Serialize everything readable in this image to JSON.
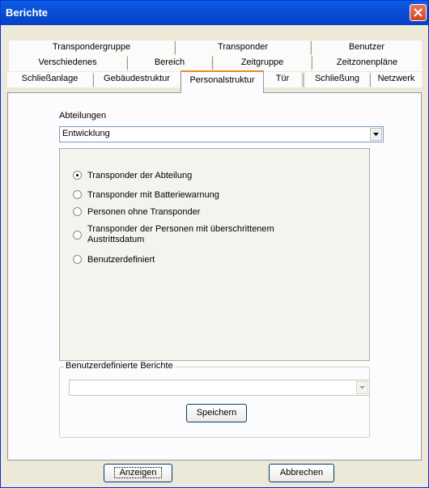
{
  "window": {
    "title": "Berichte"
  },
  "tabs": {
    "row1": [
      "Transpondergruppe",
      "Transponder",
      "Benutzer"
    ],
    "row2": [
      "Verschiedenes",
      "Bereich",
      "Zeitgruppe",
      "Zeitzonenpläne"
    ],
    "row3": [
      "Schließanlage",
      "Gebäudestruktur",
      "Personalstruktur",
      "Tür",
      "Schließung",
      "Netzwerk"
    ],
    "active": "Personalstruktur"
  },
  "departments": {
    "label": "Abteilungen",
    "value": "Entwicklung"
  },
  "options": [
    {
      "label": "Transponder der Abteilung",
      "checked": true
    },
    {
      "label": "Transponder mit Batteriewarnung",
      "checked": false
    },
    {
      "label": "Personen ohne Transponder",
      "checked": false
    },
    {
      "label_line1": "Transponder der Personen mit überschrittenem",
      "label_line2": "Austrittsdatum",
      "checked": false
    },
    {
      "label": "Benutzerdefiniert",
      "checked": false
    }
  ],
  "custom_reports": {
    "legend": "Benutzerdefinierte Berichte",
    "value": "",
    "save_label": "Speichern"
  },
  "footer": {
    "show_label": "Anzeigen",
    "cancel_label": "Abbrechen"
  }
}
